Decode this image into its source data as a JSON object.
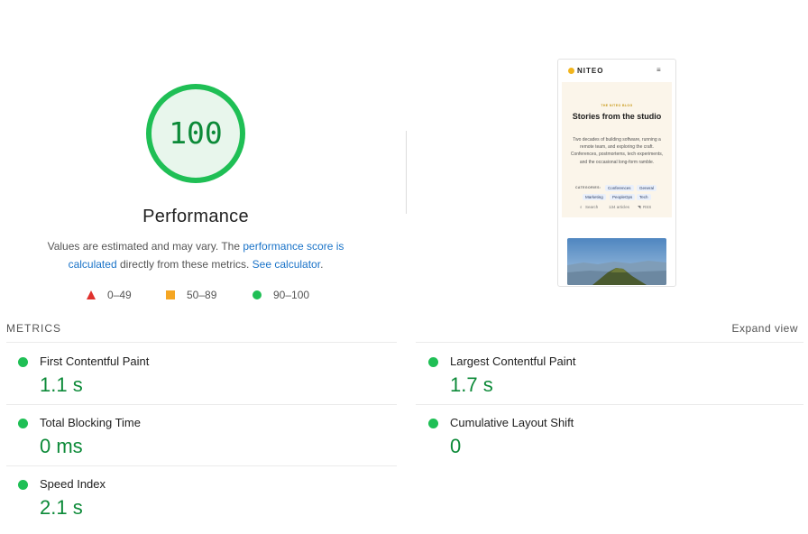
{
  "score": {
    "value": "100",
    "percent": 100,
    "color": "#0c8a38",
    "ring_color": "#1fbf55",
    "fill_color": "#e8f6ec"
  },
  "performance": {
    "title": "Performance",
    "desc_prefix": "Values are estimated and may vary. The ",
    "desc_link1": "performance score is calculated",
    "desc_middle": " directly from these metrics. ",
    "desc_link2": "See calculator",
    "desc_suffix": "."
  },
  "legend": [
    {
      "label": "0–49",
      "icon": "triangle-fail-icon",
      "color": "#e0312d"
    },
    {
      "label": "50–89",
      "icon": "square-average-icon",
      "color": "#f5a623"
    },
    {
      "label": "90–100",
      "icon": "circle-pass-icon",
      "color": "#1fbf55"
    }
  ],
  "preview": {
    "logo": "NITEO",
    "menu": "≡",
    "kicker": "THE NITEO BLOG",
    "title": "Stories from the studio",
    "text": "Two decades of building software, running a remote team, and exploring the craft. Conferences, postmortems, tech experiments, and the occasional long-form ramble.",
    "categories_label": "CATEGORIES:",
    "chips": [
      "Conferences",
      "General",
      "Marketing",
      "PeopleOps",
      "Tech"
    ],
    "search": "Search",
    "articles": "134 articles",
    "rss": "RSS"
  },
  "metrics": {
    "header": "METRICS",
    "expand": "Expand view",
    "items": [
      {
        "label": "First Contentful Paint",
        "value": "1.1 s"
      },
      {
        "label": "Largest Contentful Paint",
        "value": "1.7 s"
      },
      {
        "label": "Total Blocking Time",
        "value": "0 ms"
      },
      {
        "label": "Cumulative Layout Shift",
        "value": "0"
      },
      {
        "label": "Speed Index",
        "value": "2.1 s"
      }
    ]
  }
}
